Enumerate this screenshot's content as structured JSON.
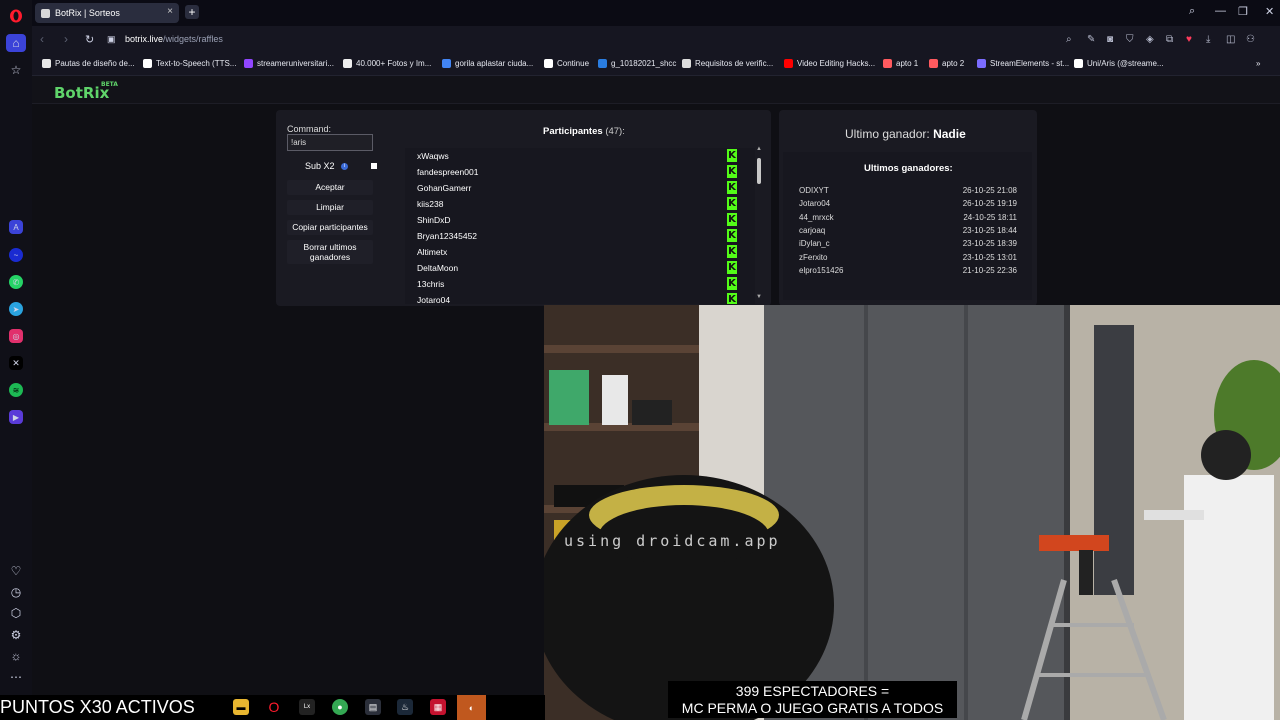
{
  "browser": {
    "tab_title": "BotRix | Sorteos",
    "tab_close": "×",
    "new_tab": "+",
    "url_host": "botrix.live",
    "url_path": "/widgets/raffles"
  },
  "bookmarks": [
    {
      "label": "Pautas de diseño de...",
      "color": "#e8e8e8"
    },
    {
      "label": "Text-to-Speech (TTS...",
      "color": "#ffffff"
    },
    {
      "label": "streameruniversitari...",
      "color": "#9146ff"
    },
    {
      "label": "40.000+ Fotos y Im...",
      "color": "#eeeeee"
    },
    {
      "label": "gorila aplastar ciuda...",
      "color": "#4285f4"
    },
    {
      "label": "Continue",
      "color": "#ffffff"
    },
    {
      "label": "g_10182021_shcc",
      "color": "#2a7de1"
    },
    {
      "label": "Requisitos de verific...",
      "color": "#dddddd"
    },
    {
      "label": "Video Editing Hacks...",
      "color": "#ff0000"
    },
    {
      "label": "apto 1",
      "color": "#ff5a5f"
    },
    {
      "label": "apto 2",
      "color": "#ff5a5f"
    },
    {
      "label": "StreamElements - st...",
      "color": "#7b6cff"
    },
    {
      "label": "Uni/Aris (@streame...",
      "color": "#ffffff"
    }
  ],
  "app": {
    "logo": "BotRix",
    "logo_badge": "BETA"
  },
  "raffle": {
    "command_label": "Command:",
    "command_value": "!aris",
    "sub_label": "Sub X2",
    "info_icon": "i",
    "accept": "Aceptar",
    "clear": "Limpiar",
    "copy": "Copiar participantes",
    "delete_winners": "Borrar ultimos ganadores",
    "participants_label": "Participantes",
    "participants_count": "(47):",
    "participants": [
      "xWaqws",
      "fandespreen001",
      "GohanGamerr",
      "kiis238",
      "ShinDxD",
      "Bryan12345452",
      "Altimetx",
      "DeltaMoon",
      "13chris",
      "Jotaro04"
    ],
    "platform_glyph": "K"
  },
  "winners": {
    "last_winner_label": "Ultimo ganador:",
    "last_winner_value": "Nadie",
    "recent_title": "Ultimos ganadores:",
    "list": [
      {
        "name": "ODIXYT",
        "date": "26-10-25 21:08"
      },
      {
        "name": "Jotaro04",
        "date": "26-10-25 19:19"
      },
      {
        "name": "44_mrxck",
        "date": "24-10-25 18:11"
      },
      {
        "name": "carjoaq",
        "date": "23-10-25 18:44"
      },
      {
        "name": "iDylan_c",
        "date": "23-10-25 18:39"
      },
      {
        "name": "zFerxito",
        "date": "23-10-25 13:01"
      },
      {
        "name": "elpro151426",
        "date": "21-10-25 22:36"
      }
    ]
  },
  "stream": {
    "watermark": "using droidcam.app",
    "ticker": "PUNTOS X30 ACTIVOS",
    "banner_line1": "399 ESPECTADORES =",
    "banner_line2": "MC PERMA O JUEGO GRATIS A TODOS"
  },
  "colors": {
    "accent_green": "#5fd46a",
    "kick_green": "#53fc18",
    "opera_red": "#ff1b2d"
  }
}
